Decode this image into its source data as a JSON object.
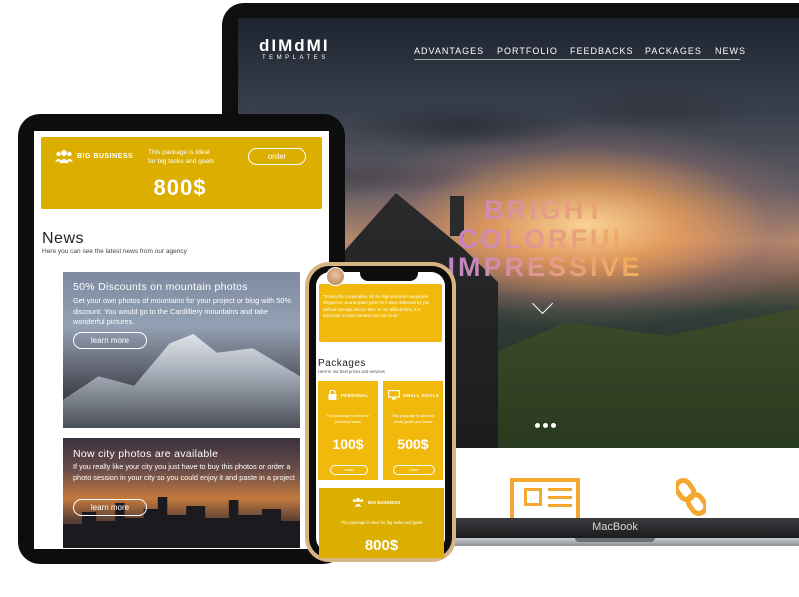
{
  "laptop": {
    "brand": "dIMdMI",
    "brand_sub": "TEMPLATES",
    "nav": [
      "ADVANTAGES",
      "PORTFOLIO",
      "FEEDBACKS",
      "PACKAGES",
      "NEWS"
    ],
    "hero_lines": [
      "BRIGHT",
      "COLORFUL",
      "IMPRESSIVE"
    ],
    "device_label": "MacBook",
    "accent": "#f5a830"
  },
  "tablet": {
    "big_business": {
      "name": "BIG BUSINESS",
      "desc_line1": "This package is ideal",
      "desc_line2": "for big tasks and goals",
      "order": "order",
      "price": "800$"
    },
    "news": {
      "title": "News",
      "subtitle": "Here you can see the latest news from our agency",
      "cards": [
        {
          "title": "50% Discounts on mountain photos",
          "text": "Get your own photos of mountains for your project or blog with 50% discount. You would go to the Cardilliery mountains and take wonderful pictures.",
          "button": "learn more"
        },
        {
          "title": "Now city photos are available",
          "text": "If you really like your city you just have to buy this photos or order a photo session in your city so you could enjoy it and paste in a project",
          "button": "learn more"
        }
      ]
    },
    "accent": "#dcae00"
  },
  "phone": {
    "quote": "\"During the cooperation, all the high-precision equipment shipped to us and spare parts for it were delivered by you without damage and on time. In our difficult time, it is important to have partners you can trust.\"",
    "packages_title": "Packages",
    "packages_subtitle": "Here're our best prices and services",
    "packages": [
      {
        "name": "PERSONAL",
        "desc": "This package is ideal for personal tasks",
        "price": "100$",
        "order": "order"
      },
      {
        "name": "SMALL GOALS",
        "desc": "This package is ideal for small goals and tasks",
        "price": "500$",
        "order": "order"
      }
    ],
    "big_business": {
      "name": "BIG BUSINESS",
      "desc": "This package is ideal for big tasks and goals",
      "price": "800$"
    },
    "accent": "#f0b90b"
  }
}
